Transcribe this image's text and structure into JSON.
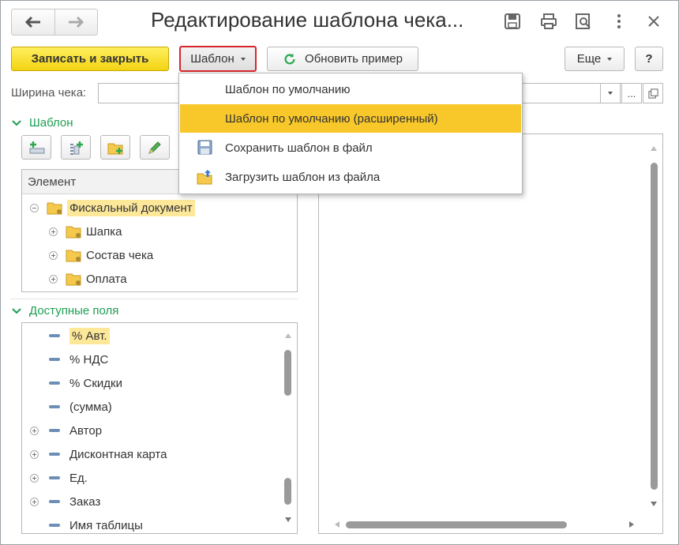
{
  "window": {
    "title": "Редактирование шаблона чека..."
  },
  "toolbar": {
    "save_close": "Записать и закрыть",
    "template": "Шаблон",
    "refresh": "Обновить пример",
    "more": "Еще",
    "help": "?"
  },
  "width_field": {
    "label": "Ширина чека:",
    "value": "",
    "more_btn": "..."
  },
  "template_group": {
    "title": "Шаблон",
    "column_header": "Элемент",
    "tree": [
      {
        "label": "Фискальный документ",
        "expanded": true,
        "selected": true
      },
      {
        "label": "Шапка",
        "expanded": false
      },
      {
        "label": "Состав чека",
        "expanded": false
      },
      {
        "label": "Оплата",
        "expanded": false
      }
    ]
  },
  "fields_group": {
    "title": "Доступные поля",
    "items": [
      {
        "label": "% Авт.",
        "has_children": false,
        "selected": true
      },
      {
        "label": "% НДС",
        "has_children": false
      },
      {
        "label": "% Скидки",
        "has_children": false
      },
      {
        "label": "(сумма)",
        "has_children": false
      },
      {
        "label": "Автор",
        "has_children": true
      },
      {
        "label": "Дисконтная карта",
        "has_children": true
      },
      {
        "label": "Ед.",
        "has_children": true
      },
      {
        "label": "Заказ",
        "has_children": true
      },
      {
        "label": "Имя таблицы",
        "has_children": false
      }
    ]
  },
  "dropdown_menu": {
    "items": [
      {
        "label": "Шаблон по умолчанию",
        "icon": "none",
        "active": false
      },
      {
        "label": "Шаблон по умолчанию (расширенный)",
        "icon": "none",
        "active": true
      },
      {
        "label": "Сохранить шаблон в файл",
        "icon": "save-disk-icon",
        "active": false
      },
      {
        "label": "Загрузить шаблон из файла",
        "icon": "folder-upload-icon",
        "active": false
      }
    ]
  },
  "colors": {
    "primary_button": "#f2d313",
    "group_title": "#1d9e52",
    "active_menu_item": "#f8c82a",
    "selection": "#fde89a",
    "template_button_border": "#d7262b"
  }
}
